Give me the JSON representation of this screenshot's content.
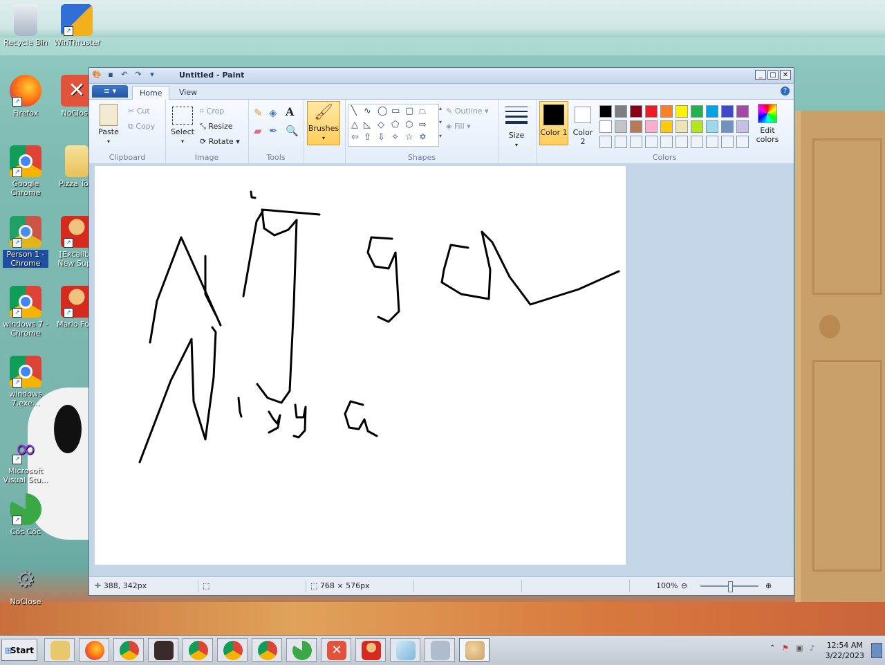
{
  "desktop": {
    "icons": [
      {
        "label": "Recycle Bin",
        "icon": "recycle-bin-icon"
      },
      {
        "label": "WinThruster",
        "icon": "winthruster-icon"
      },
      {
        "label": "Firefox",
        "icon": "firefox-icon"
      },
      {
        "label": "NoClose",
        "icon": "noclose-icon"
      },
      {
        "label": "Google Chrome",
        "icon": "chrome-icon"
      },
      {
        "label": "Pizza Tow",
        "icon": "folder-icon"
      },
      {
        "label": "Person 1 - Chrome",
        "icon": "chrome-profile-icon"
      },
      {
        "label": "[Excalibu New Supe",
        "icon": "mario-icon"
      },
      {
        "label": "windows 7 - Chrome",
        "icon": "chrome-profile-icon"
      },
      {
        "label": "Mario Fore",
        "icon": "mario-icon"
      },
      {
        "label": "windows 7.exe...",
        "icon": "chrome-profile-icon"
      },
      {
        "label": "Microsoft Visual Stu...",
        "icon": "visual-studio-icon"
      },
      {
        "label": "Cốc Cốc",
        "icon": "coccoc-icon"
      },
      {
        "label": "NoClose",
        "icon": "noclose-gear-icon"
      }
    ]
  },
  "window": {
    "title": "Untitled - Paint",
    "tabs": {
      "home": "Home",
      "view": "View"
    },
    "ribbon": {
      "clipboard": {
        "paste": "Paste",
        "cut": "Cut",
        "copy": "Copy",
        "label": "Clipboard"
      },
      "image": {
        "select": "Select",
        "crop": "Crop",
        "resize": "Resize",
        "rotate": "Rotate",
        "label": "Image"
      },
      "tools": {
        "label": "Tools",
        "text_tool": "A"
      },
      "brushes": {
        "label": "Brushes"
      },
      "shapes": {
        "outline": "Outline",
        "fill": "Fill",
        "label": "Shapes"
      },
      "size": {
        "label": "Size"
      },
      "colors": {
        "color1": "Color 1",
        "color2": "Color 2",
        "edit": "Edit colors",
        "label": "Colors",
        "color1_value": "#000000",
        "color2_value": "#ffffff",
        "palette_row1": [
          "#000000",
          "#7f7f7f",
          "#880015",
          "#ed1c24",
          "#ff7f27",
          "#fff200",
          "#22b14c",
          "#00a2e8",
          "#3f48cc",
          "#a349a4"
        ],
        "palette_row2": [
          "#ffffff",
          "#c3c3c3",
          "#b97a57",
          "#ffaec9",
          "#ffc90e",
          "#efe4b0",
          "#b5e61d",
          "#99d9ea",
          "#7092be",
          "#c8bfe7"
        ]
      }
    },
    "status": {
      "position": "388, 342px",
      "selection": "",
      "canvas_size": "768 × 576px",
      "zoom": "100%"
    }
  },
  "taskbar": {
    "start": "Start",
    "time": "12:54 AM",
    "date": "3/22/2023",
    "apps": [
      "file-explorer-icon",
      "firefox-icon",
      "chrome-icon",
      "game-icon",
      "chrome-profile-icon",
      "chrome-profile-icon",
      "chrome-profile-icon",
      "coccoc-icon",
      "noclose-icon",
      "mario-icon",
      "notepad-icon",
      "calculator-icon",
      "paint-icon"
    ]
  }
}
